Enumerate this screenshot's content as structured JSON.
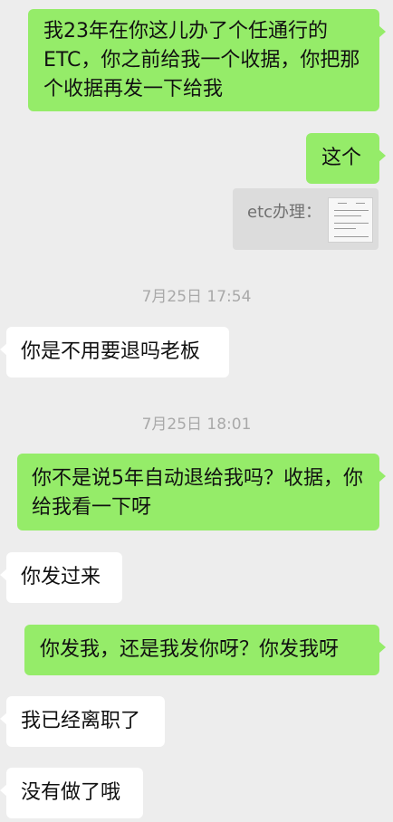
{
  "messages": [
    {
      "side": "out",
      "text": "我23年在你这儿办了个任通行的ETC，你之前给我一个收据，你把那个收据再发一下给我"
    },
    {
      "side": "out",
      "text": "这个"
    },
    {
      "side": "out",
      "type": "quote",
      "text": "etc办理："
    },
    {
      "side": "in",
      "text": "你是不用要退吗老板"
    },
    {
      "side": "out",
      "text": "你不是说5年自动退给我吗？收据，你给我看一下呀"
    },
    {
      "side": "in",
      "text": "你发过来"
    },
    {
      "side": "out",
      "text": "你发我，还是我发你呀？你发我呀"
    },
    {
      "side": "in",
      "text": "我已经离职了"
    },
    {
      "side": "in",
      "text": "没有做了哦"
    }
  ],
  "timestamps": [
    "7月25日 17:54",
    "7月25日 18:01"
  ]
}
